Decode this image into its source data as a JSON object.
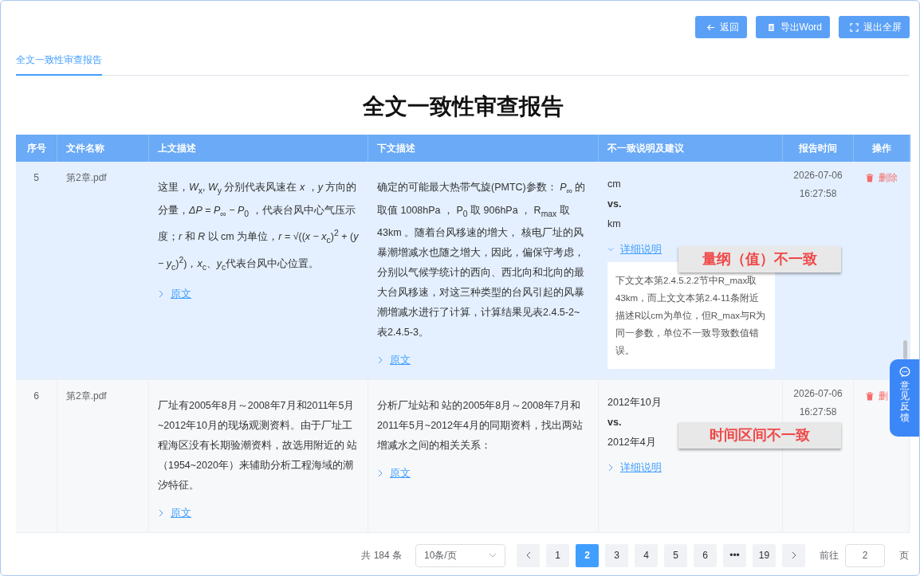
{
  "header_buttons": [
    {
      "kind": "back",
      "label": "返回"
    },
    {
      "kind": "export",
      "label": "导出Word"
    },
    {
      "kind": "fullscreen",
      "label": "退出全屏"
    }
  ],
  "tabs": [
    {
      "label": "全文一致性审查报告",
      "selected": true
    }
  ],
  "title": "全文一致性审查报告",
  "table": {
    "columns": [
      "序号",
      "文件名称",
      "上文描述",
      "下文描述",
      "不一致说明及建议",
      "报告时间",
      "操作"
    ],
    "rows": [
      {
        "highlighted": true,
        "index": "5",
        "file": "第2章.pdf",
        "upper": "这里，*W*$_{x}$, *W*$_{y}$ 分别代表风速在 *x* ，*y* 方向的分量，*ΔP* = *P*$_{∞}$ − *P*$_{0}$ ，代表台风中心气压示度；*r* 和 *R* 以 cm 为单位，*r* = √((*x* − *x*$_{c}$)$^{2}$ + (*y* − *y*$_{c}$)$^{2}$)，*x*$_{c}$、*y*$_{c}$代表台风中心位置。",
        "upper_link": "原文",
        "lower": "确定的可能最大热带气旋(PMTC)参数： *P*$_{∞}$ 的取值 1008hPa ， P$_{0}$ 取 906hPa ， R$_{max}$ 取 43km 。随着台风移速的增大，        核电厂址的风暴潮增减水也随之增大，因此，偏保守考虑，分别以气候学统计的西向、西北向和北向的最大台风移速，对这三种类型的台风引起的风暴潮增减水进行了计算，计算结果见表2.4.5-2~表2.4.5-3。",
        "lower_link": "原文",
        "value_a": "cm",
        "vs": "vs.",
        "value_b": "km",
        "detail_link": "详细说明",
        "expanded": true,
        "detail": "下文文本第2.4.5.2.2节中R_max取43km，而上文文本第2.4-11条附近描述R以cm为单位，但R_max与R为同一参数，单位不一致导致数值错误。",
        "annotation": "量纲（值）不一致",
        "date": "2026-07-06",
        "time": "16:27:58",
        "action": "删除"
      },
      {
        "highlighted": false,
        "index": "6",
        "file": "第2章.pdf",
        "upper": "厂址有2005年8月～2008年7月和2011年5月~2012年10月的现场观测资料。由于厂址工程海区没有长期验潮资料，故选用附近的        站（1954~2020年）来辅助分析工程海域的潮汐特征。",
        "upper_link": "原文",
        "lower": "分析厂址站和        站的2005年8月～2008年7月和2011年5月~2012年4月的同期资料，找出两站增减水之间的相关关系：",
        "lower_link": "原文",
        "value_a": "2012年10月",
        "vs": "vs.",
        "value_b": "2012年4月",
        "detail_link": "详细说明",
        "expanded": false,
        "annotation": "时间区间不一致",
        "date": "2026-07-06",
        "time": "16:27:58",
        "action": "删"
      }
    ]
  },
  "pagination": {
    "total": "共 184 条",
    "page_size": "10条/页",
    "pages": [
      {
        "label": "1",
        "selected": false
      },
      {
        "label": "2",
        "selected": true
      },
      {
        "label": "3",
        "selected": false
      },
      {
        "label": "4",
        "selected": false
      },
      {
        "label": "5",
        "selected": false
      },
      {
        "label": "6",
        "selected": false
      },
      {
        "label": "•••",
        "selected": false
      },
      {
        "label": "19",
        "selected": false
      }
    ],
    "goto_label": "前往",
    "goto_value": "2",
    "page_unit": "页"
  },
  "feedback": {
    "label": "意见反馈"
  }
}
